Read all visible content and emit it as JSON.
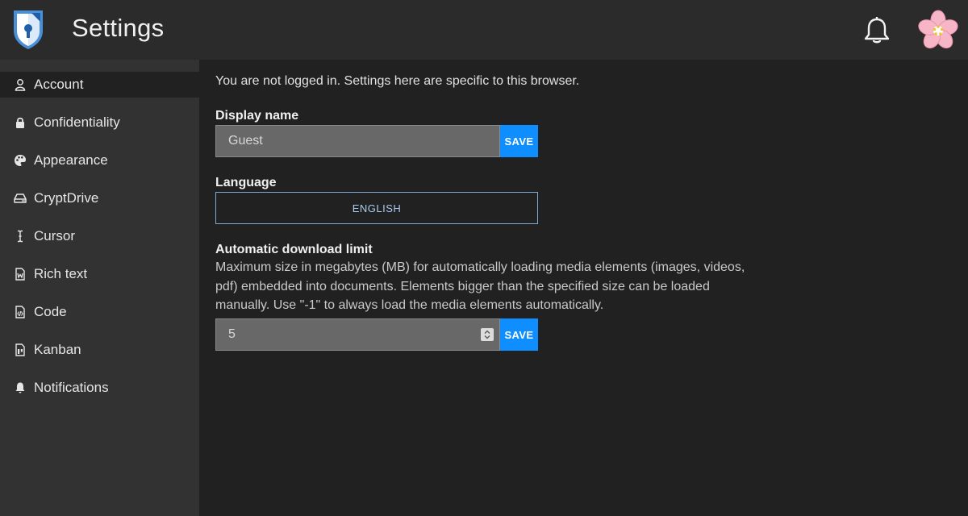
{
  "header": {
    "title": "Settings",
    "logo_icon": "cryptpad-logo-icon",
    "notifications_icon": "bell-icon",
    "avatar_icon": "cherry-blossom-avatar"
  },
  "sidebar": {
    "items": [
      {
        "label": "Account",
        "icon": "user-icon",
        "active": true
      },
      {
        "label": "Confidentiality",
        "icon": "lock-icon"
      },
      {
        "label": "Appearance",
        "icon": "palette-icon"
      },
      {
        "label": "CryptDrive",
        "icon": "hard-drive-icon"
      },
      {
        "label": "Cursor",
        "icon": "text-cursor-icon"
      },
      {
        "label": "Rich text",
        "icon": "rich-text-file-icon"
      },
      {
        "label": "Code",
        "icon": "code-file-icon"
      },
      {
        "label": "Kanban",
        "icon": "kanban-file-icon"
      },
      {
        "label": "Notifications",
        "icon": "bell-icon"
      }
    ]
  },
  "main": {
    "notice": "You are not logged in. Settings here are specific to this browser.",
    "display_name": {
      "label": "Display name",
      "value": "Guest",
      "save_label": "SAVE"
    },
    "language": {
      "label": "Language",
      "selected": "ENGLISH"
    },
    "download_limit": {
      "label": "Automatic download limit",
      "description": "Maximum size in megabytes (MB) for automatically loading media elements (images, videos, pdf) embedded into documents. Elements bigger than the specified size can be loaded manually. Use \"-1\" to always load the media elements automatically.",
      "value": "5",
      "save_label": "SAVE"
    }
  },
  "colors": {
    "accent": "#0e8eff",
    "background": "#212121",
    "sidebar": "#323232",
    "topbar": "#2b2b2b"
  }
}
